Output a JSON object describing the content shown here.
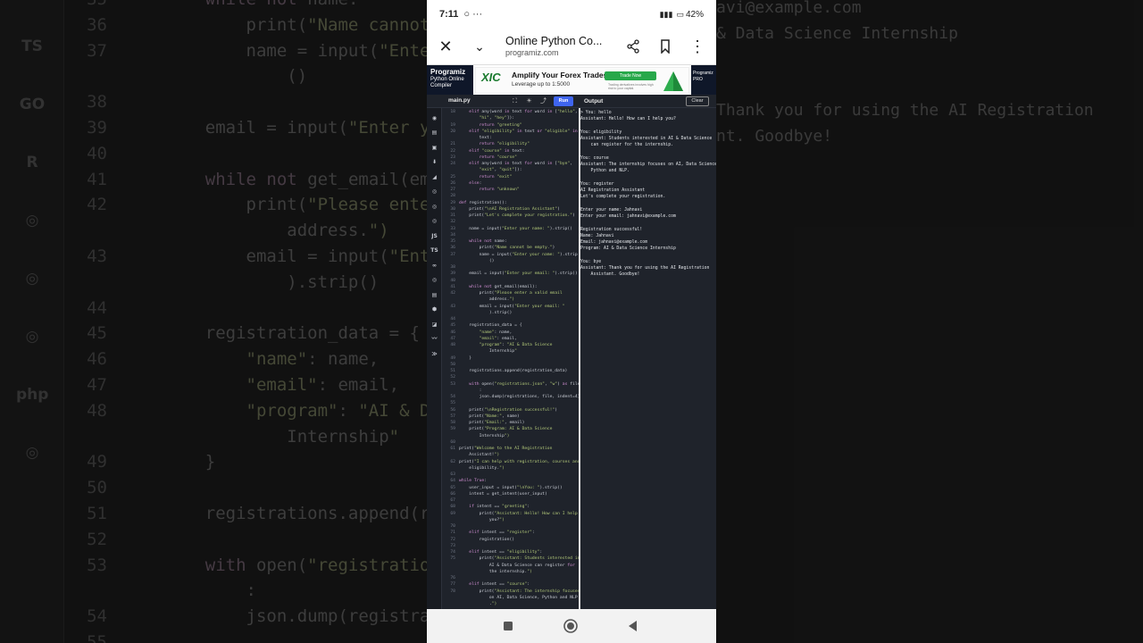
{
  "status_bar": {
    "time": "7:11",
    "notif_icons": "○ ···",
    "battery": "42%"
  },
  "browser": {
    "page_title": "Online Python Co...",
    "domain": "programiz.com"
  },
  "site_header": {
    "logo_name": "Programiz",
    "logo_sub": "Python Online Compiler",
    "pro_label": "Programiz PRO"
  },
  "ad": {
    "brand": "XIC",
    "headline": "Amplify Your Forex Trades",
    "subline": "Leverage up to 1:5000",
    "cta": "Trade Now",
    "fine_print": "Trading derivatives involves high risk to your capital."
  },
  "editor": {
    "file_name": "main.py",
    "run_label": "Run",
    "output_label": "Output",
    "clear_label": "Clear",
    "code_lines": [
      {
        "n": "18",
        "t": "    elif any(word in text for word in [\"hello\","
      },
      {
        "n": "",
        "t": "        \"hi\", \"hey\"]):"
      },
      {
        "n": "19",
        "t": "        return \"greeting\""
      },
      {
        "n": "20",
        "t": "    elif \"eligibility\" in text or \"eligible\" in"
      },
      {
        "n": "",
        "t": "        text:"
      },
      {
        "n": "21",
        "t": "        return \"eligibility\""
      },
      {
        "n": "22",
        "t": "    elif \"course\" in text:"
      },
      {
        "n": "23",
        "t": "        return \"course\""
      },
      {
        "n": "24",
        "t": "    elif any(word in text for word in [\"bye\","
      },
      {
        "n": "",
        "t": "        \"exit\", \"quit\"]):"
      },
      {
        "n": "25",
        "t": "        return \"exit\""
      },
      {
        "n": "26",
        "t": "    else:"
      },
      {
        "n": "27",
        "t": "        return \"unknown\""
      },
      {
        "n": "28",
        "t": ""
      },
      {
        "n": "29",
        "t": "def registration():"
      },
      {
        "n": "30",
        "t": "    print(\"\\nAI Registration Assistant\")"
      },
      {
        "n": "31",
        "t": "    print(\"Let's complete your registration.\")"
      },
      {
        "n": "32",
        "t": ""
      },
      {
        "n": "33",
        "t": "    name = input(\"Enter your name: \").strip()"
      },
      {
        "n": "34",
        "t": ""
      },
      {
        "n": "35",
        "t": "    while not name:"
      },
      {
        "n": "36",
        "t": "        print(\"Name cannot be empty.\")"
      },
      {
        "n": "37",
        "t": "        name = input(\"Enter your name: \").strip"
      },
      {
        "n": "",
        "t": "            ()"
      },
      {
        "n": "38",
        "t": ""
      },
      {
        "n": "39",
        "t": "    email = input(\"Enter your email: \").strip()"
      },
      {
        "n": "40",
        "t": ""
      },
      {
        "n": "41",
        "t": "    while not get_email(email):"
      },
      {
        "n": "42",
        "t": "        print(\"Please enter a valid email"
      },
      {
        "n": "",
        "t": "            address.\")"
      },
      {
        "n": "43",
        "t": "        email = input(\"Enter your email: \""
      },
      {
        "n": "",
        "t": "            ).strip()"
      },
      {
        "n": "44",
        "t": ""
      },
      {
        "n": "45",
        "t": "    registration_data = {"
      },
      {
        "n": "46",
        "t": "        \"name\": name,"
      },
      {
        "n": "47",
        "t": "        \"email\": email,"
      },
      {
        "n": "48",
        "t": "        \"program\": \"AI & Data Science"
      },
      {
        "n": "",
        "t": "            Internship\""
      },
      {
        "n": "49",
        "t": "    }"
      },
      {
        "n": "50",
        "t": ""
      },
      {
        "n": "51",
        "t": "    registrations.append(registration_data)"
      },
      {
        "n": "52",
        "t": ""
      },
      {
        "n": "53",
        "t": "    with open(\"registrations.json\", \"w\") as file"
      },
      {
        "n": "",
        "t": "        :"
      },
      {
        "n": "54",
        "t": "        json.dump(registrations, file, indent=4)"
      },
      {
        "n": "55",
        "t": ""
      },
      {
        "n": "56",
        "t": "    print(\"\\nRegistration successful!\")"
      },
      {
        "n": "57",
        "t": "    print(\"Name:\", name)"
      },
      {
        "n": "58",
        "t": "    print(\"Email:\", email)"
      },
      {
        "n": "59",
        "t": "    print(\"Program: AI & Data Science"
      },
      {
        "n": "",
        "t": "        Internship\")"
      },
      {
        "n": "60",
        "t": ""
      },
      {
        "n": "61",
        "t": "print(\"Welcome to the AI Registration"
      },
      {
        "n": "",
        "t": "    Assistant!\")"
      },
      {
        "n": "62",
        "t": "print(\"I can help with registration, courses and"
      },
      {
        "n": "",
        "t": "    eligibility.\")"
      },
      {
        "n": "63",
        "t": ""
      },
      {
        "n": "64",
        "t": "while True:"
      },
      {
        "n": "65",
        "t": "    user_input = input(\"\\nYou: \").strip()"
      },
      {
        "n": "66",
        "t": "    intent = get_intent(user_input)"
      },
      {
        "n": "67",
        "t": ""
      },
      {
        "n": "68",
        "t": "    if intent == \"greeting\":"
      },
      {
        "n": "69",
        "t": "        print(\"Assistant: Hello! How can I help"
      },
      {
        "n": "",
        "t": "            you?\")"
      },
      {
        "n": "70",
        "t": ""
      },
      {
        "n": "71",
        "t": "    elif intent == \"register\":"
      },
      {
        "n": "72",
        "t": "        registration()"
      },
      {
        "n": "73",
        "t": ""
      },
      {
        "n": "74",
        "t": "    elif intent == \"eligibility\":"
      },
      {
        "n": "75",
        "t": "        print(\"Assistant: Students interested in"
      },
      {
        "n": "",
        "t": "            AI & Data Science can register for"
      },
      {
        "n": "",
        "t": "            the internship.\")"
      },
      {
        "n": "76",
        "t": ""
      },
      {
        "n": "77",
        "t": "    elif intent == \"course\":"
      },
      {
        "n": "78",
        "t": "        print(\"Assistant: The internship focuses"
      },
      {
        "n": "",
        "t": "            on AI, Data Science, Python and NLP"
      },
      {
        "n": "",
        "t": "            .\")"
      }
    ],
    "output_lines": [
      "> You: hello",
      "Assistant: Hello! How can I help you?",
      "",
      "You: eligibility",
      "Assistant: Students interested in AI & Data Science",
      "    can register for the internship.",
      "",
      "You: course",
      "Assistant: The internship focuses on AI, Data Science,",
      "    Python and NLP.",
      "",
      "You: register",
      "AI Registration Assistant",
      "Let's complete your registration.",
      "",
      "Enter your name: Jahnavi",
      "Enter your email: jahnavi@example.com",
      "",
      "Registration successful!",
      "Name: Jahnavi",
      "Email: jahnavi@example.com",
      "Program: AI & Data Science Internship",
      "",
      "You: bye",
      "Assistant: Thank you for using the AI Registration",
      "    Assistant. Goodbye!"
    ]
  },
  "background": {
    "rail_icons": [
      "TS",
      "GO",
      "R",
      "",
      "",
      "",
      "php",
      ""
    ],
    "code_lines": [
      {
        "n": "35",
        "t": "    while not name:"
      },
      {
        "n": "36",
        "t": "        print(\"Name cannot be e"
      },
      {
        "n": "37",
        "t": "        name = input(\"Enter yo"
      },
      {
        "n": "",
        "t": "            ()"
      },
      {
        "n": "38",
        "t": ""
      },
      {
        "n": "39",
        "t": "    email = input(\"Enter your e"
      },
      {
        "n": "40",
        "t": ""
      },
      {
        "n": "41",
        "t": "    while not get_email(email):"
      },
      {
        "n": "42",
        "t": "        print(\"Please enter a v"
      },
      {
        "n": "",
        "t": "            address.\")"
      },
      {
        "n": "43",
        "t": "        email = input(\"Enter yo"
      },
      {
        "n": "",
        "t": "            ).strip()"
      },
      {
        "n": "44",
        "t": ""
      },
      {
        "n": "45",
        "t": "    registration_data = {"
      },
      {
        "n": "46",
        "t": "        \"name\": name,"
      },
      {
        "n": "47",
        "t": "        \"email\": email,"
      },
      {
        "n": "48",
        "t": "        \"program\": \"AI & Data S"
      },
      {
        "n": "",
        "t": "            Internship\""
      },
      {
        "n": "49",
        "t": "    }"
      },
      {
        "n": "50",
        "t": ""
      },
      {
        "n": "51",
        "t": "    registrations.append(regist"
      },
      {
        "n": "52",
        "t": ""
      },
      {
        "n": "53",
        "t": "    with open(\"registrations.js"
      },
      {
        "n": "",
        "t": "        :"
      },
      {
        "n": "54",
        "t": "        json.dump(registrations"
      },
      {
        "n": "55",
        "t": ""
      }
    ],
    "right_lines": [
      "avi@example.com",
      "& Data Science Internship",
      "",
      "",
      "Thank you for using the AI Registration",
      "nt. Goodbye!"
    ]
  }
}
